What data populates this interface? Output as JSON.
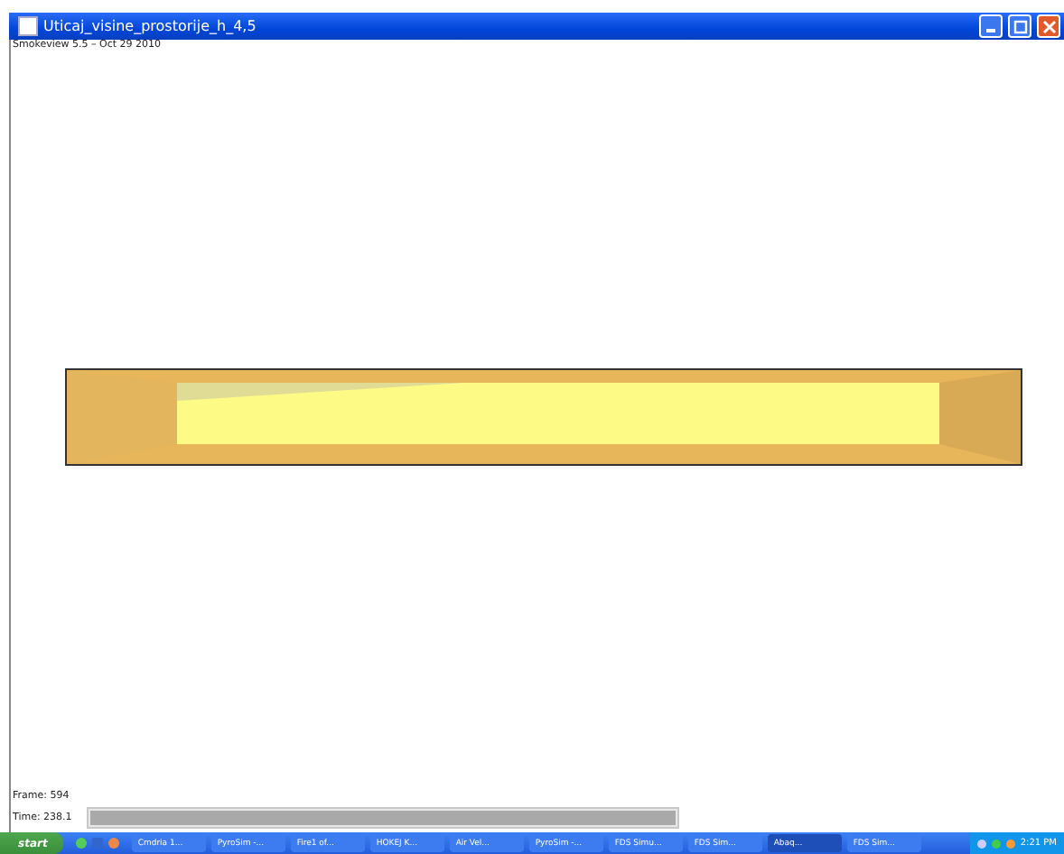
{
  "window": {
    "title": "Uticaj_visine_prostorije_h_4,5"
  },
  "viewer": {
    "version_label": "Smokeview 5.5 – Oct 29 2010",
    "frame_label": "Frame: 594",
    "time_label": "Time: 238.1",
    "time_bar": {
      "level": 1
    }
  },
  "taskbar": {
    "start_label": "start",
    "tasks": [
      {
        "label": "Cmdria 1...",
        "selected": false
      },
      {
        "label": "PyroSim -...",
        "selected": false
      },
      {
        "label": "Fire1 of...",
        "selected": false
      },
      {
        "label": "HOKEJ K...",
        "selected": false
      },
      {
        "label": "Air Vel...",
        "selected": false
      },
      {
        "label": "PyroSim -...",
        "selected": false
      },
      {
        "label": "FDS Simu...",
        "selected": false
      },
      {
        "label": "FDS Sim...",
        "selected": false
      },
      {
        "label": "Abaq...",
        "selected": true
      },
      {
        "label": "FDS Sim...",
        "selected": false
      }
    ],
    "clock": "2:21 PM"
  }
}
